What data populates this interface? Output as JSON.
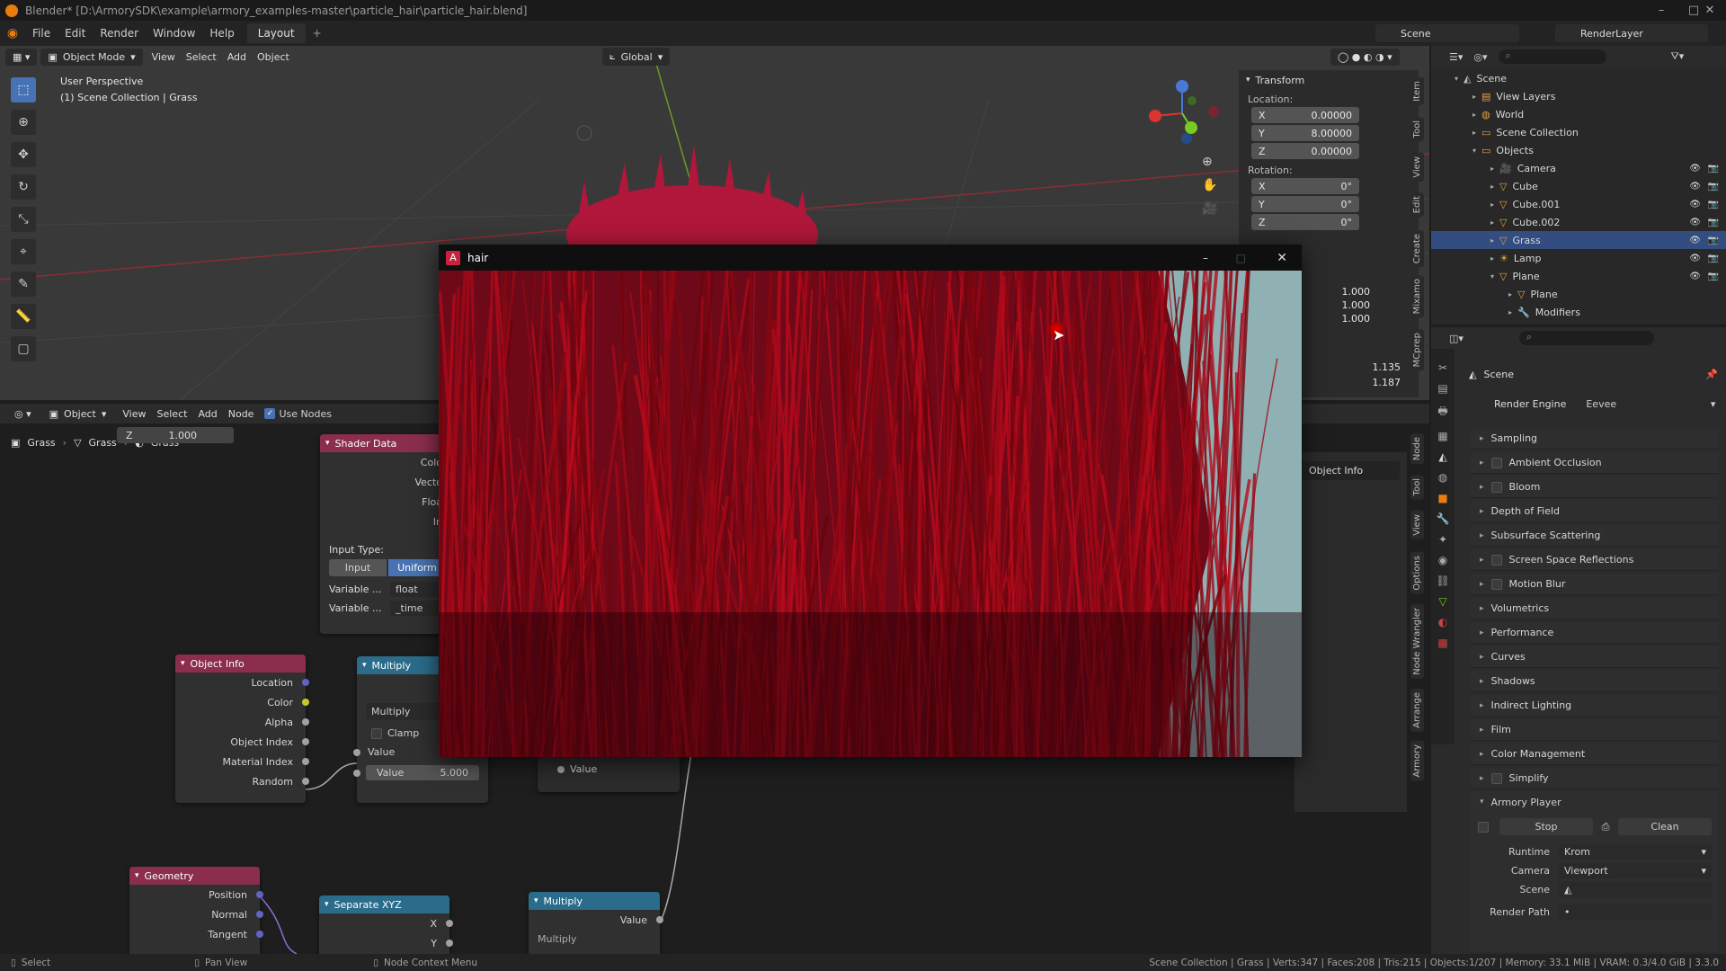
{
  "window": {
    "title": "Blender* [D:\\ArmorySDK\\example\\armory_examples-master\\particle_hair\\particle_hair.blend]"
  },
  "menubar": {
    "items": [
      "File",
      "Edit",
      "Render",
      "Window",
      "Help"
    ],
    "workspace_tab": "Layout",
    "add_tab": "+",
    "scene_label": "Scene",
    "renderlayer_label": "RenderLayer"
  },
  "viewport": {
    "mode": "Object Mode",
    "menu": [
      "View",
      "Select",
      "Add",
      "Object"
    ],
    "orientation": "Global",
    "overlay_title": "User Perspective",
    "overlay_sub": "(1) Scene Collection | Grass",
    "gizmo_axes": [
      "X",
      "Y",
      "Z"
    ]
  },
  "npanel": {
    "header": "Transform",
    "location_label": "Location:",
    "location": [
      {
        "axis": "X",
        "value": "0.00000"
      },
      {
        "axis": "Y",
        "value": "8.00000"
      },
      {
        "axis": "Z",
        "value": "0.00000"
      }
    ],
    "rotation_label": "Rotation:",
    "rotation": [
      {
        "axis": "X",
        "value": "0°"
      },
      {
        "axis": "Y",
        "value": "0°"
      },
      {
        "axis": "Z",
        "value": "0°"
      }
    ],
    "scale": [
      "1.000",
      "1.000",
      "1.000"
    ],
    "dims": [
      "1.135",
      "1.187"
    ],
    "tabs": [
      "Item",
      "Tool",
      "View",
      "Edit",
      "Create",
      "Mixamo",
      "MCprep"
    ]
  },
  "node_editor": {
    "editor_type": "Object",
    "menu": [
      "View",
      "Select",
      "Add",
      "Node"
    ],
    "use_nodes_label": "Use Nodes",
    "breadcrumb": [
      "Grass",
      "Grass",
      "Grass"
    ],
    "z_popup": {
      "label": "Z",
      "value": "1.000"
    },
    "side_tabs": [
      "Node",
      "Tool",
      "View",
      "Options",
      "Node Wrangler",
      "Arrange",
      "Armory"
    ],
    "side_field": "Object Info",
    "shader_data": {
      "title": "Shader Data",
      "outputs": [
        "Colo",
        "Vecto",
        "Floa",
        "In"
      ],
      "input_type_label": "Input Type:",
      "input_btn": "Input",
      "uniform_btn": "Uniform",
      "var1_label": "Variable ...",
      "var1_value": "float",
      "var2_label": "Variable ...",
      "var2_value": "_time"
    },
    "object_info": {
      "title": "Object Info",
      "outputs": [
        "Location",
        "Color",
        "Alpha",
        "Object Index",
        "Material Index",
        "Random"
      ]
    },
    "multiply1": {
      "title": "Multiply",
      "op": "Multiply",
      "clamp": "Clamp",
      "value_label": "Value",
      "value_field_label": "Value",
      "value_field": "5.000"
    },
    "value_socket": "Value",
    "geometry": {
      "title": "Geometry",
      "outputs": [
        "Position",
        "Normal",
        "Tangent"
      ]
    },
    "separate": {
      "title": "Separate XYZ",
      "outputs": [
        "X",
        "Y"
      ]
    },
    "multiply2": {
      "title": "Multiply",
      "output": "Value",
      "op": "Multiply"
    }
  },
  "outliner": {
    "root": "Scene",
    "rows": [
      {
        "label": "View Layers",
        "indent": 1
      },
      {
        "label": "World",
        "indent": 1
      },
      {
        "label": "Scene Collection",
        "indent": 1
      },
      {
        "label": "Objects",
        "indent": 1
      },
      {
        "label": "Camera",
        "indent": 2
      },
      {
        "label": "Cube",
        "indent": 2
      },
      {
        "label": "Cube.001",
        "indent": 2
      },
      {
        "label": "Cube.002",
        "indent": 2
      },
      {
        "label": "Grass",
        "indent": 2,
        "selected": true
      },
      {
        "label": "Lamp",
        "indent": 2
      },
      {
        "label": "Plane",
        "indent": 2
      },
      {
        "label": "Plane",
        "indent": 3
      },
      {
        "label": "Modifiers",
        "indent": 3
      }
    ]
  },
  "properties": {
    "context": "Scene",
    "render_engine_label": "Render Engine",
    "render_engine": "Eevee",
    "panels": [
      {
        "label": "Sampling",
        "check": false
      },
      {
        "label": "Ambient Occlusion",
        "check": true
      },
      {
        "label": "Bloom",
        "check": true
      },
      {
        "label": "Depth of Field",
        "check": false
      },
      {
        "label": "Subsurface Scattering",
        "check": false
      },
      {
        "label": "Screen Space Reflections",
        "check": true
      },
      {
        "label": "Motion Blur",
        "check": true
      },
      {
        "label": "Volumetrics",
        "check": false
      },
      {
        "label": "Performance",
        "check": false
      },
      {
        "label": "Curves",
        "check": false
      },
      {
        "label": "Shadows",
        "check": false
      },
      {
        "label": "Indirect Lighting",
        "check": false
      },
      {
        "label": "Film",
        "check": false
      },
      {
        "label": "Color Management",
        "check": false
      },
      {
        "label": "Simplify",
        "check": true
      }
    ],
    "armory": {
      "title": "Armory Player",
      "stop": "Stop",
      "clean": "Clean",
      "runtime_label": "Runtime",
      "runtime": "Krom",
      "camera_label": "Camera",
      "camera": "Viewport",
      "scene_label": "Scene",
      "render_path_label": "Render Path"
    }
  },
  "hair_window": {
    "title": "hair"
  },
  "statusbar": {
    "left": "Select",
    "mid1": "Pan View",
    "mid2": "Node Context Menu",
    "right": "Scene Collection | Grass | Verts:347 | Faces:208 | Tris:215 | Objects:1/207 | Memory: 33.1 MiB | VRAM: 0.3/4.0 GiB | 3.3.0"
  },
  "colors": {
    "accent": "#4772b3",
    "selection": "#334d80",
    "grass": "#8a0d22",
    "sky": "#8fb1b4"
  }
}
